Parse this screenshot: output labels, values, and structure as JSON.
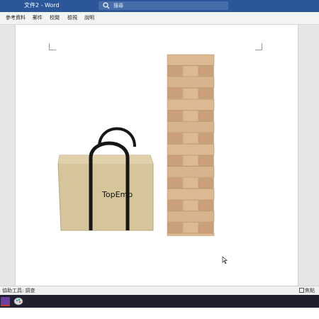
{
  "window": {
    "title": "文件2 - Word",
    "search_placeholder": "搜尋"
  },
  "ribbon": {
    "tabs": [
      {
        "label": "參考資料"
      },
      {
        "label": "郵件"
      },
      {
        "label": "校閱"
      },
      {
        "label": "檢視"
      },
      {
        "label": "說明"
      }
    ]
  },
  "document": {
    "image": {
      "bag_brand_text": "TopEmp"
    }
  },
  "statusbar": {
    "accessibility": "協助工具: 調查",
    "right_text": "焦點"
  },
  "colors": {
    "titlebar": "#2b579a",
    "wood_light": "#ddb992",
    "wood_dark": "#c9a079",
    "bag": "#d6c49a",
    "strap": "#161616"
  },
  "taskbar": {
    "icons": [
      "word-app-icon",
      "paint-app-icon"
    ]
  }
}
